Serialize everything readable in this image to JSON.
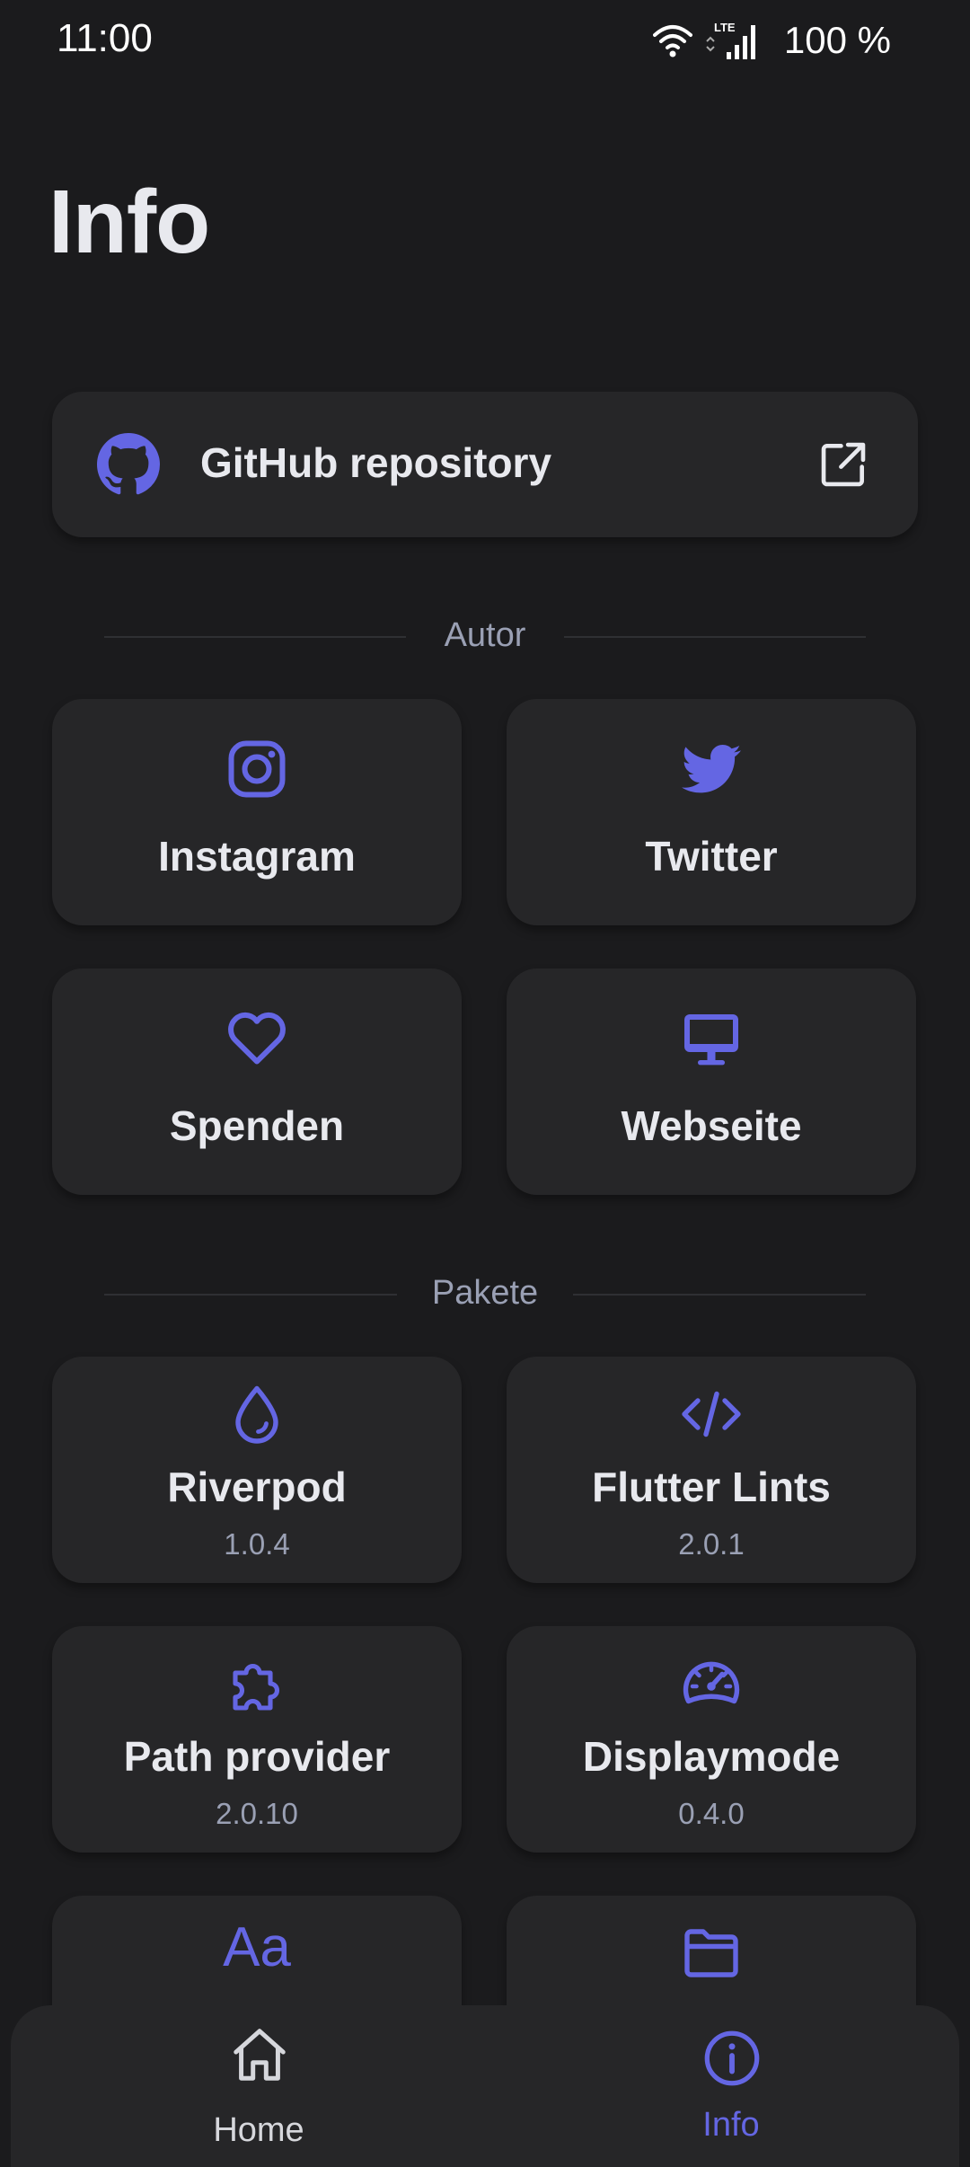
{
  "status_bar": {
    "time": "11:00",
    "battery": "100 %",
    "network": "LTE"
  },
  "title": "Info",
  "github": {
    "label": "GitHub repository"
  },
  "sections": {
    "author": "Autor",
    "packages": "Pakete"
  },
  "author_tiles": [
    {
      "label": "Instagram",
      "icon": "instagram-icon"
    },
    {
      "label": "Twitter",
      "icon": "twitter-icon"
    },
    {
      "label": "Spenden",
      "icon": "heart-icon"
    },
    {
      "label": "Webseite",
      "icon": "desktop-icon"
    }
  ],
  "packages": [
    {
      "name": "Riverpod",
      "version": "1.0.4",
      "icon": "drop-icon"
    },
    {
      "name": "Flutter Lints",
      "version": "2.0.1",
      "icon": "code-icon"
    },
    {
      "name": "Path provider",
      "version": "2.0.10",
      "icon": "puzzle-icon"
    },
    {
      "name": "Displaymode",
      "version": "0.4.0",
      "icon": "gauge-icon"
    }
  ],
  "partial_tile_icons": {
    "left": "Aa",
    "right": "folder-icon"
  },
  "nav": {
    "home": "Home",
    "info": "Info"
  },
  "colors": {
    "accent": "#6466e3",
    "background": "#1b1b1d",
    "card": "#262628",
    "text": "#e8e9ee",
    "muted": "#9aa0b4"
  }
}
